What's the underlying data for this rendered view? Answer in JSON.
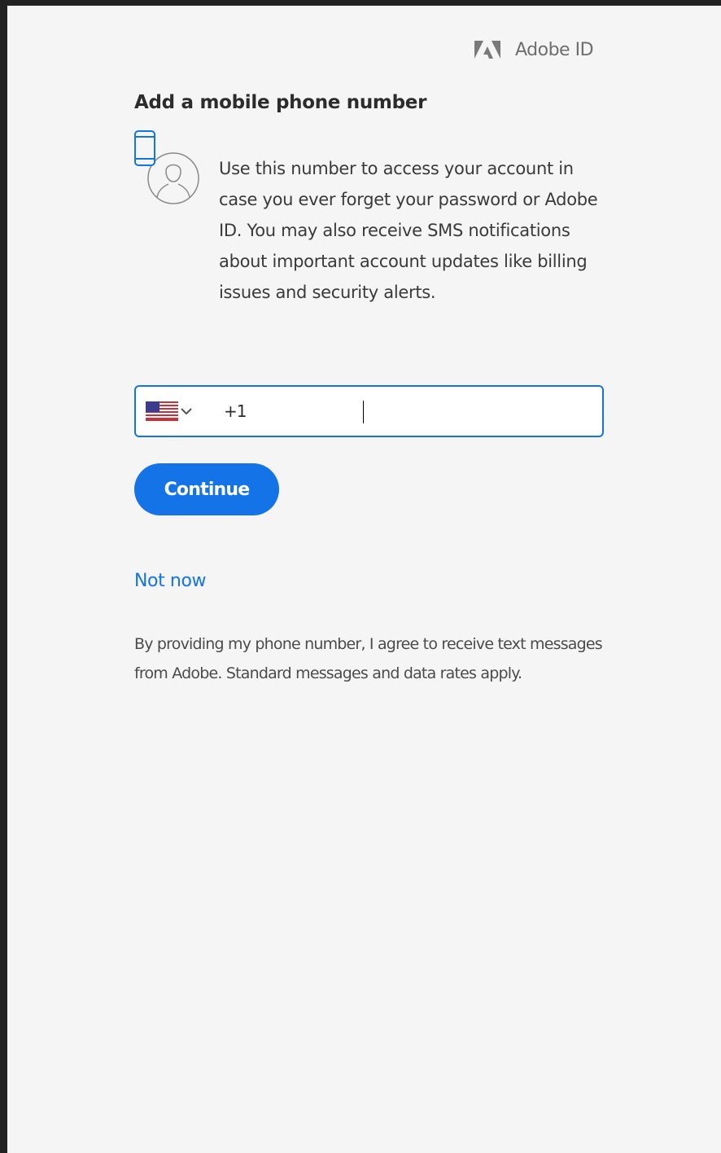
{
  "header": {
    "brand_label": "Adobe ID",
    "logo_icon": "adobe-logo-icon"
  },
  "page": {
    "title": "Add a mobile phone number",
    "illustration_icon": "phone-user-icon",
    "description": "Use this number to access your account in case you ever forget your password or Adobe ID. You may also receive SMS notifications about important account updates like billing issues and security alerts."
  },
  "phone_field": {
    "country_flag_icon": "us-flag-icon",
    "chevron_icon": "chevron-down-icon",
    "value": "+1"
  },
  "actions": {
    "continue_label": "Continue",
    "not_now_label": "Not now"
  },
  "legal": {
    "text": "By providing my phone number, I agree to receive text messages from Adobe. Standard messages and data rates apply."
  },
  "colors": {
    "accent": "#1473e6",
    "background": "#f5f5f5",
    "title_text": "#2c2c2c",
    "body_text": "#3a3a3a",
    "muted_text": "#6e6e6e"
  }
}
